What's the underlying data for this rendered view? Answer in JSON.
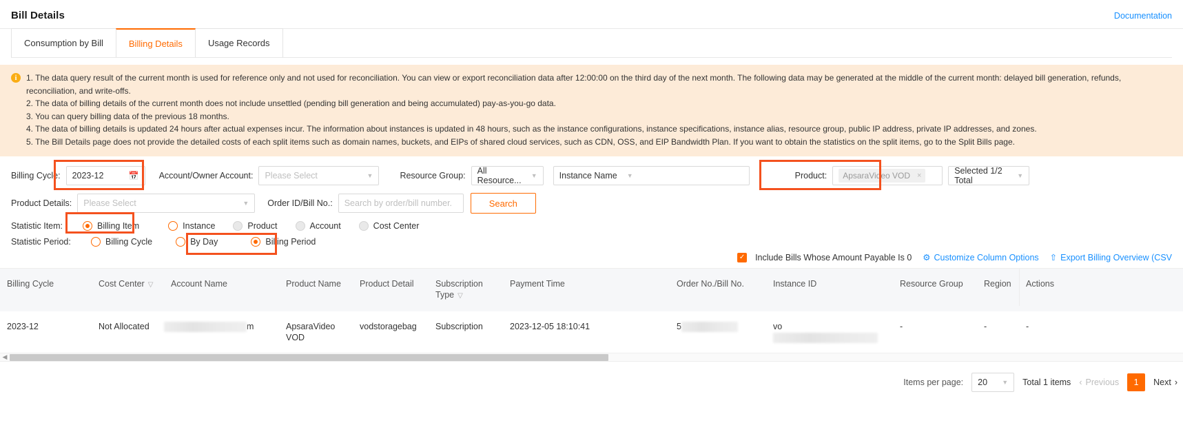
{
  "header": {
    "title": "Bill Details",
    "doc_link": "Documentation"
  },
  "tabs": [
    {
      "label": "Consumption by Bill",
      "active": false
    },
    {
      "label": "Billing Details",
      "active": true
    },
    {
      "label": "Usage Records",
      "active": false
    }
  ],
  "notice": {
    "icon": "info-icon",
    "lines": [
      "1. The data query result of the current month is used for reference only and not used for reconciliation. You can view or export reconciliation data after 12:00:00 on the third day of the next month. The following data may be generated at the middle of the current month: delayed bill generation, refunds, reconciliation, and write-offs.",
      "2. The data of billing details of the current month does not include unsettled (pending bill generation and being accumulated) pay-as-you-go data.",
      "3. You can query billing data of the previous 18 months.",
      "4. The data of billing details is updated 24 hours after actual expenses incur. The information about instances is updated in 48 hours, such as the instance configurations, instance specifications, instance alias, resource group, public IP address, private IP addresses, and zones.",
      "5. The Bill Details page does not provide the detailed costs of each split items such as domain names, buckets, and EIPs of shared cloud services, such as CDN, OSS, and EIP Bandwidth Plan. If you want to obtain the statistics on the split items, go to the Split Bills page."
    ]
  },
  "filters": {
    "billing_cycle": {
      "label": "Billing Cycle:",
      "value": "2023-12",
      "icon": "calendar-icon"
    },
    "account_owner": {
      "label": "Account/Owner Account:",
      "placeholder": "Please Select"
    },
    "resource_group": {
      "label": "Resource Group:",
      "value": "All Resource..."
    },
    "instance_name": {
      "value": "Instance Name"
    },
    "product": {
      "label": "Product:",
      "tag": "ApsaraVideo VOD",
      "tag_close": "×"
    },
    "product_selected": {
      "value": "Selected 1/2 Total"
    },
    "product_details": {
      "label": "Product Details:",
      "placeholder": "Please Select"
    },
    "order_id": {
      "label": "Order ID/Bill No.:",
      "placeholder": "Search by order/bill number."
    },
    "search_button": "Search"
  },
  "statistic_item": {
    "label": "Statistic Item:",
    "options": [
      {
        "label": "Billing Item",
        "state": "selected"
      },
      {
        "label": "Instance",
        "state": "enabled"
      },
      {
        "label": "Product",
        "state": "disabled"
      },
      {
        "label": "Account",
        "state": "disabled"
      },
      {
        "label": "Cost Center",
        "state": "disabled"
      }
    ]
  },
  "statistic_period": {
    "label": "Statistic Period:",
    "options": [
      {
        "label": "Billing Cycle",
        "state": "enabled"
      },
      {
        "label": "By Day",
        "state": "enabled"
      },
      {
        "label": "Billing Period",
        "state": "selected"
      }
    ]
  },
  "table_toolbar": {
    "include_zero_label": "Include Bills Whose Amount Payable Is 0",
    "include_zero_checked": true,
    "customize_columns": "Customize Column Options",
    "customize_icon": "gear-icon",
    "export_label": "Export Billing Overview (CSV",
    "export_icon": "upload-icon"
  },
  "table": {
    "columns": [
      {
        "label": "Billing Cycle",
        "filter": false
      },
      {
        "label": "Cost Center",
        "filter": true
      },
      {
        "label": "Account Name",
        "filter": false
      },
      {
        "label": "Product Name",
        "filter": false
      },
      {
        "label": "Product Detail",
        "filter": false
      },
      {
        "label": "Subscription Type",
        "filter": true
      },
      {
        "label": "Payment Time",
        "filter": false
      },
      {
        "label": "Order No./Bill No.",
        "filter": false
      },
      {
        "label": "Instance ID",
        "filter": false
      },
      {
        "label": "Resource Group",
        "filter": false
      },
      {
        "label": "Region",
        "filter": false
      },
      {
        "label": "Actions",
        "filter": false
      }
    ],
    "rows": [
      {
        "billing_cycle": "2023-12",
        "cost_center": "Not Allocated",
        "account_name_suffix": "m",
        "product_name": "ApsaraVideo VOD",
        "product_detail": "vodstoragebag",
        "subscription_type": "Subscription",
        "payment_time": "2023-12-05 18:10:41",
        "order_no_prefix": "5",
        "instance_id_prefix": "vo",
        "resource_group": "-",
        "region": "-",
        "actions": "-"
      }
    ]
  },
  "pagination": {
    "items_per_page_label": "Items per page:",
    "items_per_page_value": "20",
    "total": "Total 1 items",
    "previous": "Previous",
    "current_page": "1",
    "next": "Next"
  },
  "colors": {
    "accent": "#ff6a00",
    "link": "#1890ff",
    "notice_bg": "#fdebd8",
    "annotation": "#f4511e"
  }
}
